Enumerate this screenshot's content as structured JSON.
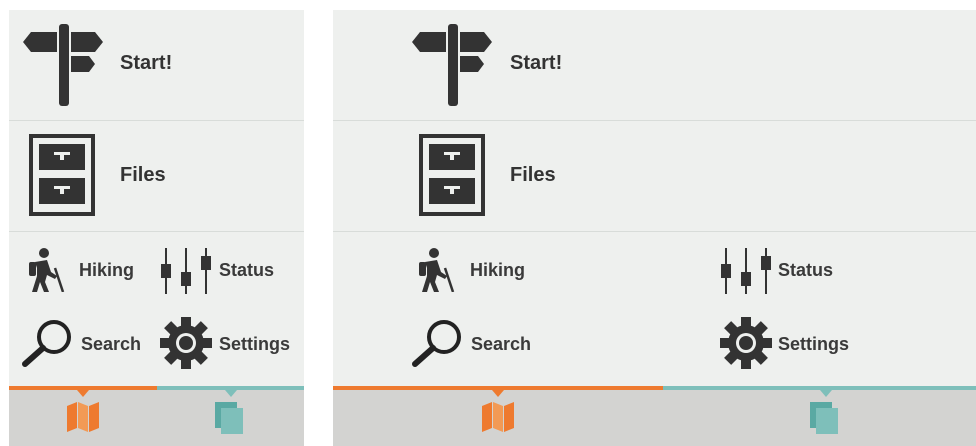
{
  "menu": {
    "start_label": "Start!",
    "files_label": "Files",
    "hiking_label": "Hiking",
    "status_label": "Status",
    "search_label": "Search",
    "settings_label": "Settings"
  },
  "tabs": [
    {
      "icon": "map-icon",
      "state": "active"
    },
    {
      "icon": "documents-icon",
      "state": "inactive"
    }
  ],
  "colors": {
    "background": "#eef0ee",
    "text": "#333333",
    "accent_active": "#ee7a2f",
    "accent_inactive": "#7ebfba",
    "tabbar": "#d3d3d1"
  }
}
